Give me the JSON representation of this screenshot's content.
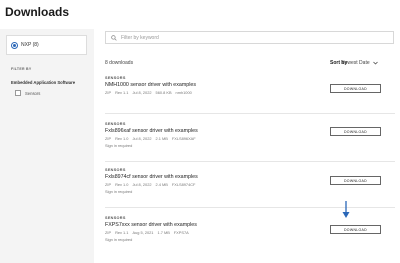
{
  "page": {
    "title": "Downloads"
  },
  "sidebar": {
    "vendor": {
      "label": "NXP (8)"
    },
    "filter_heading": "FILTER BY",
    "filter_group": "Embedded Application Software",
    "filter_option": "Sensors"
  },
  "search": {
    "placeholder": "Filter by keyword"
  },
  "results": {
    "count_text": "8 downloads",
    "sort_label": "Sort by",
    "sort_value": "Newest Date"
  },
  "items": [
    {
      "category": "SENSORS",
      "title": "NMH1000 sensor driver with examples",
      "type": "ZIP",
      "rev": "Rev 1.1",
      "date": "Jul 8, 2022",
      "size": "560.8 KB",
      "part": "nmh1000",
      "signin": "",
      "button": "DOWNLOAD"
    },
    {
      "category": "SENSORS",
      "title": "Fxls896xaf sensor driver with examples",
      "type": "ZIP",
      "rev": "Rev 1.0",
      "date": "Jul 8, 2022",
      "size": "2.1 MB",
      "part": "FXLS896XAF",
      "signin": "Sign in required",
      "button": "DOWNLOAD"
    },
    {
      "category": "SENSORS",
      "title": "Fxls8974cf sensor driver with examples",
      "type": "ZIP",
      "rev": "Rev 1.0",
      "date": "Jul 8, 2022",
      "size": "2.4 MB",
      "part": "FXLS8974CF",
      "signin": "Sign in required",
      "button": "DOWNLOAD"
    },
    {
      "category": "SENSORS",
      "title": "FXPS7xxx sensor driver with examples",
      "type": "ZIP",
      "rev": "Rev 1.1",
      "date": "Aug 5, 2021",
      "size": "1.7 MB",
      "part": "FXPS7A",
      "signin": "Sign in required",
      "button": "DOWNLOAD"
    }
  ],
  "colors": {
    "accent": "#2a67b8",
    "sidebar_bg": "#f4f4f4"
  },
  "icons": {
    "search": "search-icon",
    "sort": "chevron-down-icon",
    "pointer": "arrow-down-icon"
  }
}
